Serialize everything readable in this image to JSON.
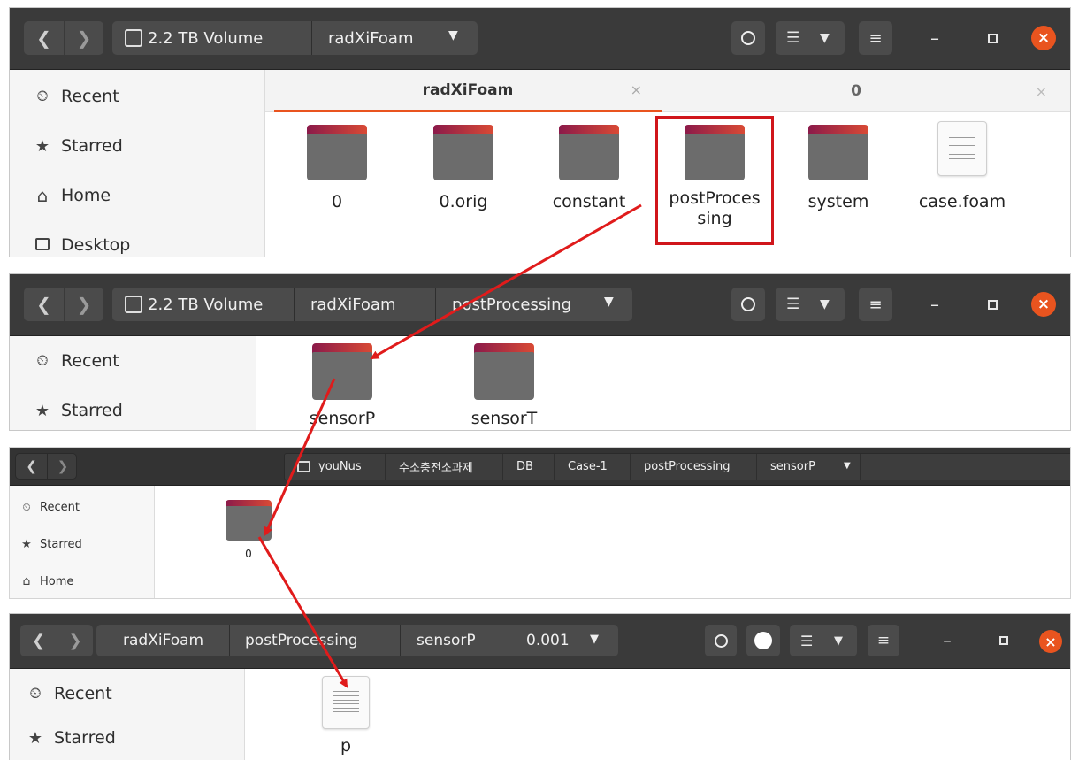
{
  "window1": {
    "path": [
      "2.2 TB Volume",
      "radXiFoam"
    ],
    "tabs": [
      {
        "label": "radXiFoam",
        "close": "×"
      },
      {
        "label": "0",
        "close": "×"
      }
    ],
    "sidebar": [
      {
        "icon": "clock-icon",
        "glyph": "🕔",
        "label": "Recent"
      },
      {
        "icon": "star-icon",
        "glyph": "★",
        "label": "Starred"
      },
      {
        "icon": "home-icon",
        "glyph": "⌂",
        "label": "Home"
      },
      {
        "icon": "desktop-icon",
        "glyph": "☐",
        "label": "Desktop"
      }
    ],
    "items": [
      {
        "type": "folder",
        "name": "0"
      },
      {
        "type": "folder",
        "name": "0.orig"
      },
      {
        "type": "folder",
        "name": "constant"
      },
      {
        "type": "folder",
        "name": "postProces\nsing",
        "highlighted": true
      },
      {
        "type": "folder",
        "name": "system"
      },
      {
        "type": "file",
        "name": "case.foam"
      }
    ]
  },
  "window2": {
    "path": [
      "2.2 TB Volume",
      "radXiFoam",
      "postProcessing"
    ],
    "sidebar": [
      {
        "icon": "clock-icon",
        "glyph": "🕔",
        "label": "Recent"
      },
      {
        "icon": "star-icon",
        "glyph": "★",
        "label": "Starred"
      }
    ],
    "items": [
      {
        "type": "folder",
        "name": "sensorP"
      },
      {
        "type": "folder",
        "name": "sensorT"
      }
    ]
  },
  "window3": {
    "path": [
      "youNus",
      "수소충전소과제",
      "DB",
      "Case-1",
      "postProcessing",
      "sensorP"
    ],
    "sidebar": [
      {
        "icon": "clock-icon",
        "glyph": "🕔",
        "label": "Recent"
      },
      {
        "icon": "star-icon",
        "glyph": "★",
        "label": "Starred"
      },
      {
        "icon": "home-icon",
        "glyph": "⌂",
        "label": "Home"
      }
    ],
    "items": [
      {
        "type": "folder",
        "name": "0"
      }
    ]
  },
  "window4": {
    "path": [
      "radXiFoam",
      "postProcessing",
      "sensorP",
      "0.001"
    ],
    "sidebar": [
      {
        "icon": "clock-icon",
        "glyph": "🕔",
        "label": "Recent"
      },
      {
        "icon": "star-icon",
        "glyph": "★",
        "label": "Starred"
      }
    ],
    "items": [
      {
        "type": "file",
        "name": "p"
      }
    ]
  },
  "colors": {
    "titlebar": "#3a3a3a",
    "accent": "#e9541f",
    "highlight_box": "#d0161b",
    "arrow": "#e01b1b",
    "folder_tab": "#b8264a",
    "folder_body": "#6c6c6c"
  }
}
